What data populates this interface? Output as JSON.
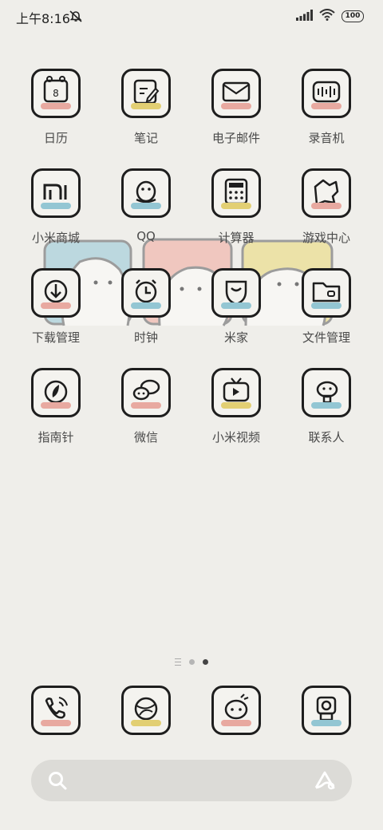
{
  "status_bar": {
    "time": "上午8:16",
    "battery": "100",
    "icons": [
      "mute-bell-icon",
      "signal-icon",
      "wifi-icon",
      "battery-icon"
    ]
  },
  "apps": [
    {
      "label": "日历",
      "icon": "calendar-icon",
      "stripe": "#e8a9a0"
    },
    {
      "label": "笔记",
      "icon": "notes-icon",
      "stripe": "#e2cf73"
    },
    {
      "label": "电子邮件",
      "icon": "mail-icon",
      "stripe": "#e8a9a0"
    },
    {
      "label": "录音机",
      "icon": "recorder-icon",
      "stripe": "#e8a9a0"
    },
    {
      "label": "小米商城",
      "icon": "mi-store-icon",
      "stripe": "#93c6d3"
    },
    {
      "label": "QQ",
      "icon": "qq-icon",
      "stripe": "#93c6d3"
    },
    {
      "label": "计算器",
      "icon": "calculator-icon",
      "stripe": "#e2cf73"
    },
    {
      "label": "游戏中心",
      "icon": "game-center-icon",
      "stripe": "#e8a9a0"
    },
    {
      "label": "下载管理",
      "icon": "download-icon",
      "stripe": "#e8a9a0"
    },
    {
      "label": "时钟",
      "icon": "clock-icon",
      "stripe": "#93c6d3"
    },
    {
      "label": "米家",
      "icon": "mijia-icon",
      "stripe": "#93c6d3"
    },
    {
      "label": "文件管理",
      "icon": "folder-icon",
      "stripe": "#93c6d3"
    },
    {
      "label": "指南针",
      "icon": "compass-icon",
      "stripe": "#e8a9a0"
    },
    {
      "label": "微信",
      "icon": "wechat-icon",
      "stripe": "#e8a9a0"
    },
    {
      "label": "小米视频",
      "icon": "video-icon",
      "stripe": "#e2cf73"
    },
    {
      "label": "联系人",
      "icon": "contacts-icon",
      "stripe": "#93c6d3"
    }
  ],
  "dock": [
    {
      "icon": "phone-icon",
      "stripe": "#e8a9a0"
    },
    {
      "icon": "browser-icon",
      "stripe": "#e2cf73"
    },
    {
      "icon": "messages-icon",
      "stripe": "#e8a9a0"
    },
    {
      "icon": "camera-icon",
      "stripe": "#93c6d3"
    }
  ],
  "pager": {
    "pages": 3,
    "active": 2
  },
  "search": {
    "icons": [
      "search-icon",
      "assistant-icon"
    ]
  },
  "colors": {
    "background": "#efeeea",
    "pink": "#e8a9a0",
    "yellow": "#e2cf73",
    "blue": "#93c6d3"
  }
}
